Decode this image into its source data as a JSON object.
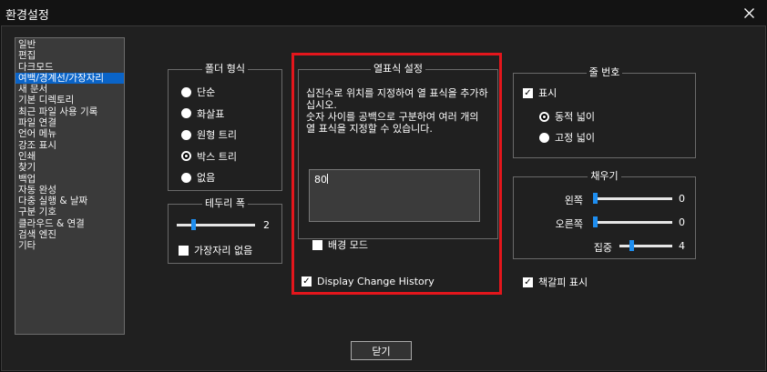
{
  "window": {
    "title": "환경설정"
  },
  "categories": [
    {
      "label": "일반"
    },
    {
      "label": "편집"
    },
    {
      "label": "다크모드"
    },
    {
      "label": "여백/경계선/가장자리",
      "selected": true
    },
    {
      "label": "새 문서"
    },
    {
      "label": "기본 디렉토리"
    },
    {
      "label": "최근 파일 사용 기록"
    },
    {
      "label": "파일 연결"
    },
    {
      "label": "언어 메뉴"
    },
    {
      "label": "강조 표시"
    },
    {
      "label": "인쇄"
    },
    {
      "label": "찾기"
    },
    {
      "label": "백업"
    },
    {
      "label": "자동 완성"
    },
    {
      "label": "다중 실행 & 날짜"
    },
    {
      "label": "구분 기호"
    },
    {
      "label": "클라우드 & 연결"
    },
    {
      "label": "검색 엔진"
    },
    {
      "label": "기타"
    }
  ],
  "folder_style": {
    "title": "폴더 형식",
    "options": [
      "단순",
      "화살표",
      "원형 트리",
      "박스 트리",
      "없음"
    ],
    "selected_index": 3
  },
  "border_width": {
    "title": "테두리 폭",
    "value": 2,
    "min": 0,
    "max": 10,
    "value_text": "2",
    "no_edge_label": "가장자리 없음",
    "no_edge_checked": false
  },
  "column_marker": {
    "title": "열표식 설정",
    "description": "십진수로 위치를 지정하여 열 표식을 추가하십시오.\n숫자 사이를 공백으로 구분하여 여러 개의 열 표식을 지정할 수 있습니다.",
    "input_value": "80",
    "bg_mode_label": "배경 모드",
    "bg_mode_checked": false,
    "history_label": "Display Change History",
    "history_checked": true
  },
  "line_numbers": {
    "title": "줄 번호",
    "show_label": "표시",
    "show_checked": true,
    "options": [
      "동적 넓이",
      "고정 넓이"
    ],
    "selected_index": 0
  },
  "padding": {
    "title": "채우기",
    "left_label": "왼쪽",
    "left_value": 0,
    "left_text": "0",
    "right_label": "오른쪽",
    "right_value": 0,
    "right_text": "0",
    "focus_label": "집중",
    "focus_value": 4,
    "focus_text": "4",
    "max": 20
  },
  "bookmark": {
    "label": "책갈피 표시",
    "checked": true
  },
  "close_button": {
    "label": "닫기"
  },
  "colors": {
    "accent": "#1e8ef0",
    "highlight": "#e3161c",
    "selection": "#0a64c8"
  }
}
